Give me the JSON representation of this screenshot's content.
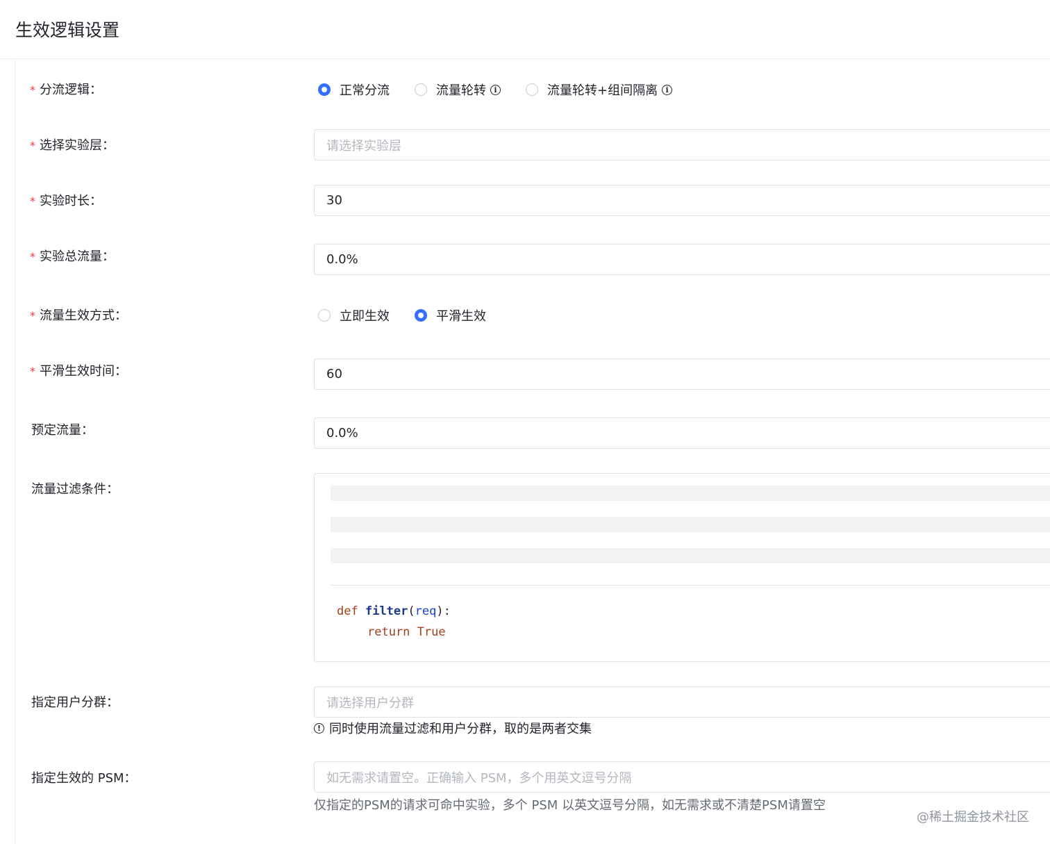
{
  "section_title": "生效逻辑设置",
  "fields": {
    "traffic_logic": {
      "label": "分流逻辑：",
      "options": [
        {
          "label": "正常分流",
          "checked": true
        },
        {
          "label": "流量轮转",
          "checked": false
        },
        {
          "label": "流量轮转+组间隔离",
          "checked": false
        }
      ]
    },
    "experiment_layer": {
      "label": "选择实验层：",
      "placeholder": "请选择实验层"
    },
    "duration": {
      "label": "实验时长：",
      "value": "30"
    },
    "total_traffic": {
      "label": "实验总流量：",
      "value": "0.0%"
    },
    "effect_mode": {
      "label": "流量生效方式：",
      "options": [
        {
          "label": "立即生效",
          "checked": false
        },
        {
          "label": "平滑生效",
          "checked": true
        }
      ]
    },
    "smooth_time": {
      "label": "平滑生效时间：",
      "value": "60"
    },
    "reserved_traffic": {
      "label": "预定流量：",
      "value": "0.0%"
    },
    "filter": {
      "label": "流量过滤条件：",
      "code": {
        "kw_def": "def",
        "fn_name": "filter",
        "paren_open": "(",
        "param": "req",
        "paren_close": "):",
        "kw_return": "return",
        "kw_true": "True"
      }
    },
    "user_group": {
      "label": "指定用户分群：",
      "placeholder": "请选择用户分群",
      "hint": "同时使用流量过滤和用户分群，取的是两者交集"
    },
    "psm": {
      "label": "指定生效的 PSM：",
      "placeholder": "如无需求请置空。正确输入 PSM，多个用英文逗号分隔",
      "help": "仅指定的PSM的请求可命中实验，多个 PSM 以英文逗号分隔，如无需求或不清楚PSM请置空"
    }
  },
  "required_mark": "*",
  "info_icon_glyph": "i",
  "warn_icon_glyph": "!",
  "footer_watermark": "@稀土掘金技术社区",
  "colors": {
    "accent": "#3370ff",
    "required": "#e23c39",
    "keyword": "#a0401a",
    "function": "#1d3b8c",
    "param": "#1a3ed8"
  }
}
